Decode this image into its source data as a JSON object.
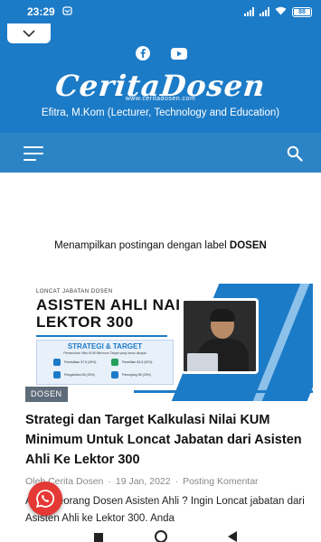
{
  "status_bar": {
    "time": "23:29",
    "battery": "88"
  },
  "header": {
    "logo_text": "CeritaDosen",
    "logo_url": "www.ceritadosen.com",
    "tagline": "Efitra, M.Kom (Lecturer, Technology and Education)",
    "social_icons": [
      "facebook-icon",
      "youtube-icon"
    ]
  },
  "label_heading": {
    "prefix": "Menampilkan postingan dengan label ",
    "label": "DOSEN"
  },
  "post": {
    "thumbnail": {
      "small_title": "LONCAT JABATAN DOSEN",
      "line1": "ASISTEN AHLI NAIK",
      "line2": "LEKTOR 300",
      "strategy_title": "STRATEGI & TARGET",
      "strategy_sub": "Pemenuhan Nilai KUM Minimum Target yang harus dicapai",
      "items": [
        {
          "label": "Pendidikan 97,5 (35%)",
          "color": "#1c7bc7"
        },
        {
          "label": "Penelitian 83,5 (30%)",
          "color": "#23a05a"
        },
        {
          "label": "Pengabdian 55 (20%)",
          "color": "#1c7bc7"
        },
        {
          "label": "Penunjang 55 (20%)",
          "color": "#1c7bc7"
        }
      ]
    },
    "tag": "DOSEN",
    "title": "Strategi dan Target Kalkulasi Nilai KUM Minimum Untuk Loncat Jabatan dari Asisten Ahli Ke Lektor 300",
    "author": "Oleh Cerita Dosen",
    "date": "19 Jan, 2022",
    "comment_link": "Posting Komentar",
    "excerpt": "Anda seorang Dosen Asisten Ahli ? Ingin Loncat jabatan dari Asisten Ahli ke Lektor 300. Anda"
  },
  "colors": {
    "brand": "#1c7bc7",
    "navbar": "#2d84c5",
    "tag_bg": "#5e6b78",
    "whatsapp_button": "#e53935"
  }
}
